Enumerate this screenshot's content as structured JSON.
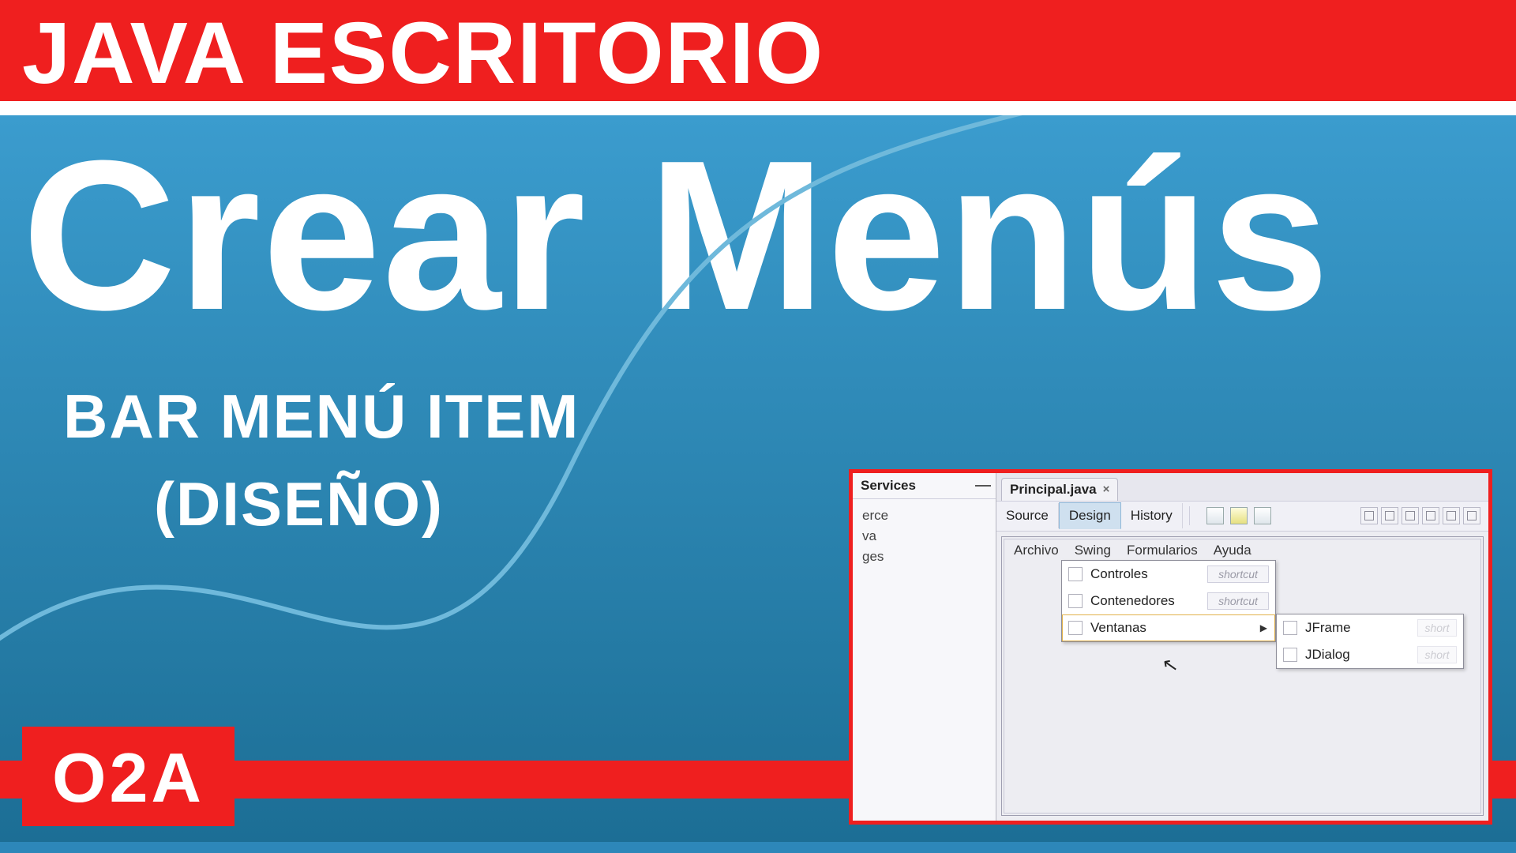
{
  "banner": {
    "top": "JAVA ESCRITORIO"
  },
  "main": {
    "title": "Crear Menús",
    "subtitle1": "BAR MENÚ ITEM",
    "subtitle2": "(DISEÑO)"
  },
  "badge": "O2A",
  "ide": {
    "left_panel_title": "Services",
    "tree": [
      "erce",
      "va",
      "ges"
    ],
    "editor_tab": "Principal.java",
    "view_tabs": {
      "source": "Source",
      "design": "Design",
      "history": "History"
    },
    "menubar": [
      "Archivo",
      "Swing",
      "Formularios",
      "Ayuda"
    ],
    "submenu": {
      "items": [
        {
          "label": "Controles",
          "shortcut": "shortcut"
        },
        {
          "label": "Contenedores",
          "shortcut": "shortcut"
        },
        {
          "label": "Ventanas",
          "arrow": true
        }
      ]
    },
    "submenu2": [
      {
        "label": "JFrame",
        "shortcut": "short"
      },
      {
        "label": "JDialog",
        "shortcut": "short"
      }
    ]
  }
}
